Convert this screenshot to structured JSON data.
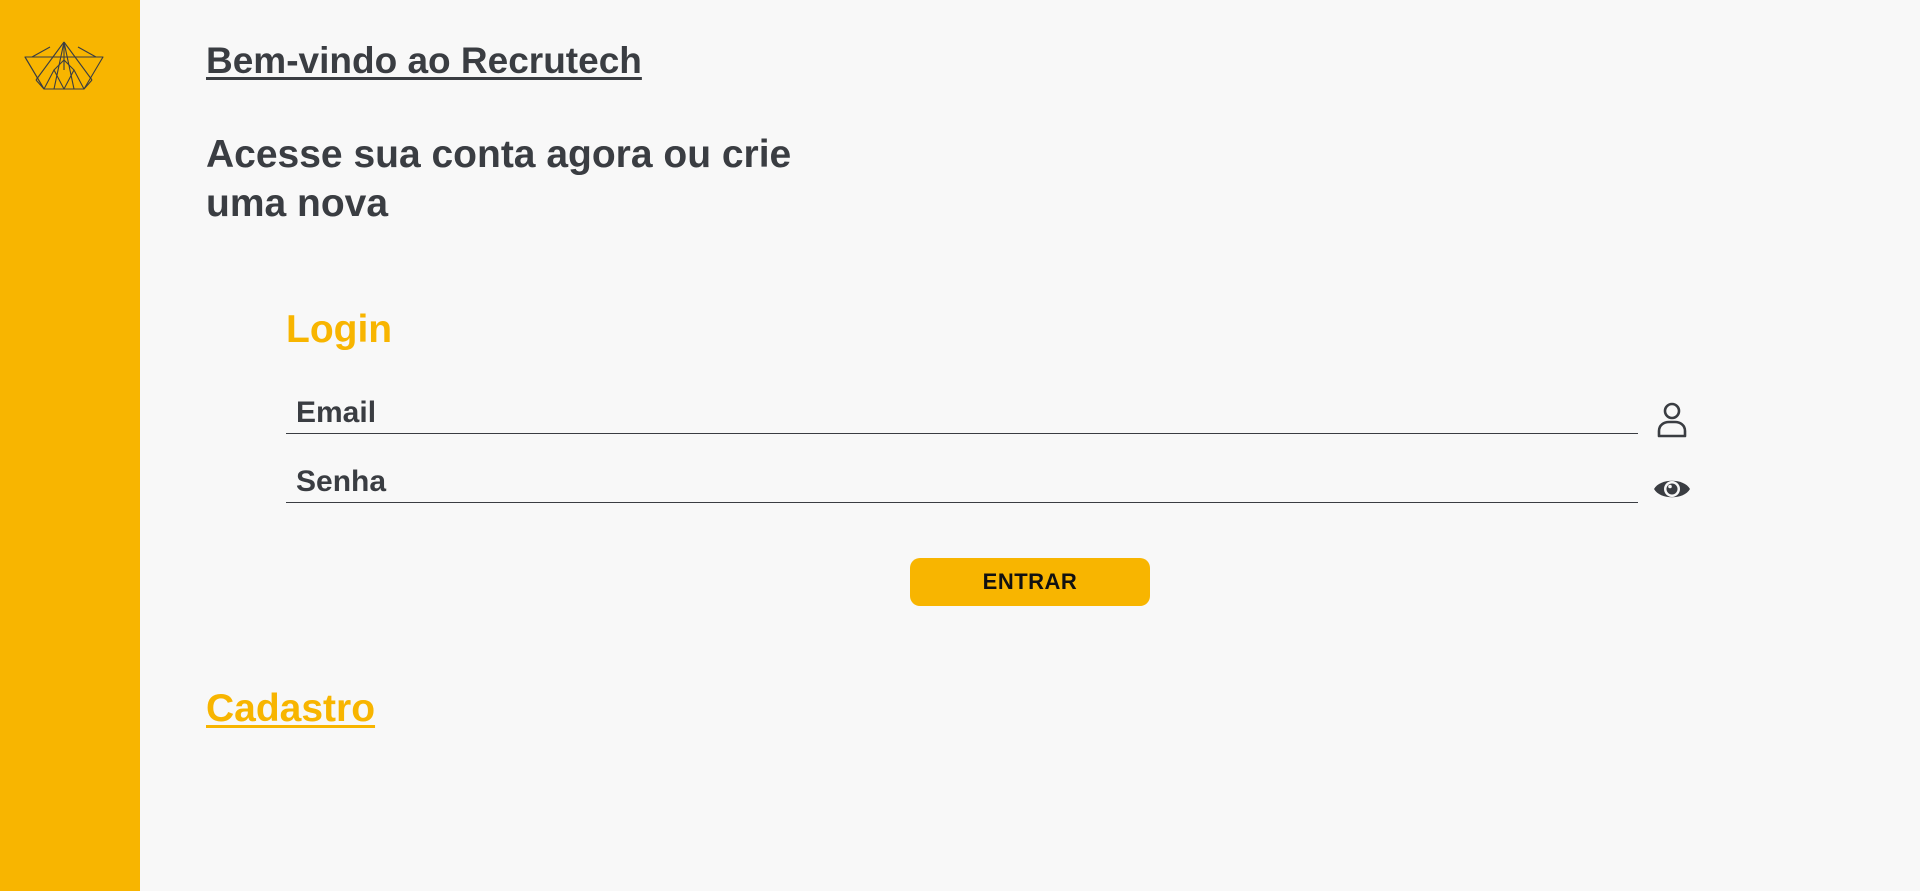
{
  "sidebar": {
    "logo_icon": "paper-boat-logo-icon",
    "background_color": "#f8b500"
  },
  "header": {
    "welcome": "Bem-vindo ao Recrutech",
    "subtitle": "Acesse sua conta agora ou crie uma nova"
  },
  "login": {
    "title": "Login",
    "email": {
      "placeholder": "Email",
      "value": "",
      "icon": "user-icon"
    },
    "password": {
      "placeholder": "Senha",
      "value": "",
      "icon": "eye-icon"
    },
    "submit_label": "ENTRAR"
  },
  "signup": {
    "link_label": "Cadastro"
  },
  "colors": {
    "accent": "#f8b500",
    "text": "#3a3d42",
    "background": "#f8f8f8"
  }
}
